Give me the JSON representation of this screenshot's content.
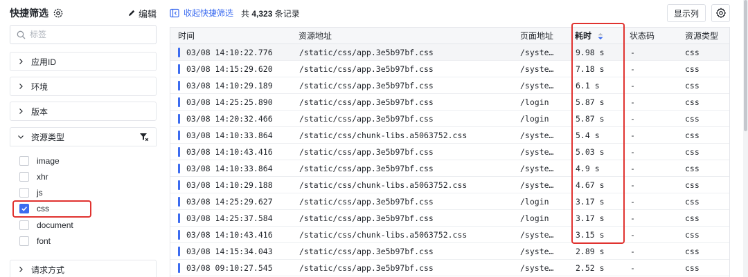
{
  "sidebar": {
    "title": "快捷筛选",
    "edit_label": "编辑",
    "search_placeholder": "标签",
    "groups": [
      {
        "label": "应用ID"
      },
      {
        "label": "环境"
      },
      {
        "label": "版本"
      },
      {
        "label": "资源类型"
      },
      {
        "label": "请求方式"
      }
    ],
    "resource_options": [
      {
        "label": "image",
        "checked": false
      },
      {
        "label": "xhr",
        "checked": false
      },
      {
        "label": "js",
        "checked": false
      },
      {
        "label": "css",
        "checked": true
      },
      {
        "label": "document",
        "checked": false
      },
      {
        "label": "font",
        "checked": false
      }
    ]
  },
  "toolbar": {
    "collapse_label": "收起快捷筛选",
    "count_prefix": "共",
    "count_value": "4,323",
    "count_suffix": "条记录",
    "display_columns_label": "显示列"
  },
  "table": {
    "columns": [
      "时间",
      "资源地址",
      "页面地址",
      "耗时",
      "状态码",
      "资源类型"
    ],
    "sort_column": "耗时",
    "sort_direction": "desc",
    "rows": [
      {
        "time": "03/08 14:10:22.776",
        "resource": "/static/css/app.3e5b97bf.css",
        "page": "/syste…",
        "duration": "9.98 s",
        "status": "-",
        "type": "css"
      },
      {
        "time": "03/08 14:15:29.620",
        "resource": "/static/css/app.3e5b97bf.css",
        "page": "/syste…",
        "duration": "7.18 s",
        "status": "-",
        "type": "css"
      },
      {
        "time": "03/08 14:10:29.189",
        "resource": "/static/css/app.3e5b97bf.css",
        "page": "/syste…",
        "duration": "6.1 s",
        "status": "-",
        "type": "css"
      },
      {
        "time": "03/08 14:25:25.890",
        "resource": "/static/css/app.3e5b97bf.css",
        "page": "/login",
        "duration": "5.87 s",
        "status": "-",
        "type": "css"
      },
      {
        "time": "03/08 14:20:32.466",
        "resource": "/static/css/app.3e5b97bf.css",
        "page": "/login",
        "duration": "5.87 s",
        "status": "-",
        "type": "css"
      },
      {
        "time": "03/08 14:10:33.864",
        "resource": "/static/css/chunk-libs.a5063752.css",
        "page": "/syste…",
        "duration": "5.4 s",
        "status": "-",
        "type": "css"
      },
      {
        "time": "03/08 14:10:43.416",
        "resource": "/static/css/app.3e5b97bf.css",
        "page": "/syste…",
        "duration": "5.03 s",
        "status": "-",
        "type": "css"
      },
      {
        "time": "03/08 14:10:33.864",
        "resource": "/static/css/app.3e5b97bf.css",
        "page": "/syste…",
        "duration": "4.9 s",
        "status": "-",
        "type": "css"
      },
      {
        "time": "03/08 14:10:29.188",
        "resource": "/static/css/chunk-libs.a5063752.css",
        "page": "/syste…",
        "duration": "4.67 s",
        "status": "-",
        "type": "css"
      },
      {
        "time": "03/08 14:25:29.627",
        "resource": "/static/css/app.3e5b97bf.css",
        "page": "/login",
        "duration": "3.17 s",
        "status": "-",
        "type": "css"
      },
      {
        "time": "03/08 14:25:37.584",
        "resource": "/static/css/app.3e5b97bf.css",
        "page": "/login",
        "duration": "3.17 s",
        "status": "-",
        "type": "css"
      },
      {
        "time": "03/08 14:10:43.416",
        "resource": "/static/css/chunk-libs.a5063752.css",
        "page": "/syste…",
        "duration": "3.15 s",
        "status": "-",
        "type": "css"
      },
      {
        "time": "03/08 14:15:34.043",
        "resource": "/static/css/app.3e5b97bf.css",
        "page": "/syste…",
        "duration": "2.89 s",
        "status": "-",
        "type": "css"
      },
      {
        "time": "03/08 09:10:27.545",
        "resource": "/static/css/app.3e5b97bf.css",
        "page": "/syste…",
        "duration": "2.52 s",
        "status": "-",
        "type": "css"
      }
    ]
  },
  "colors": {
    "accent": "#3c6cf0",
    "highlight": "#e0322f"
  }
}
